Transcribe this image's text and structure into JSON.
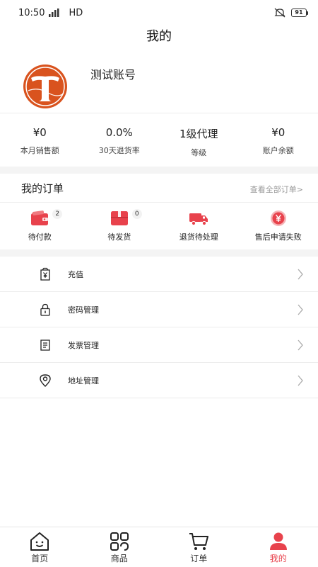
{
  "status_bar": {
    "time": "10:50",
    "network": "HD",
    "battery": "91"
  },
  "header": {
    "title": "我的"
  },
  "profile": {
    "username": "测试账号"
  },
  "stats": [
    {
      "value": "¥0",
      "label": "本月销售额"
    },
    {
      "value": "0.0%",
      "label": "30天退货率"
    },
    {
      "value": "1级代理",
      "label": "等级"
    },
    {
      "value": "¥0",
      "label": "账户余额"
    }
  ],
  "orders": {
    "title": "我的订单",
    "view_all": "查看全部订单>",
    "items": [
      {
        "label": "待付款",
        "badge": "2",
        "icon": "wallet-icon"
      },
      {
        "label": "待发货",
        "badge": "0",
        "icon": "gift-box-icon"
      },
      {
        "label": "退货待处理",
        "icon": "truck-icon"
      },
      {
        "label": "售后申请失败",
        "icon": "yen-coin-icon"
      }
    ]
  },
  "menu": [
    {
      "label": "充值",
      "icon": "recharge-icon"
    },
    {
      "label": "密码管理",
      "icon": "lock-icon"
    },
    {
      "label": "发票管理",
      "icon": "invoice-icon"
    },
    {
      "label": "地址管理",
      "icon": "location-icon"
    }
  ],
  "tabbar": [
    {
      "label": "首页",
      "icon": "home-icon"
    },
    {
      "label": "商品",
      "icon": "grid-icon"
    },
    {
      "label": "订单",
      "icon": "cart-icon"
    },
    {
      "label": "我的",
      "icon": "person-icon",
      "active": true
    }
  ],
  "colors": {
    "accent": "#e8424c",
    "logo": "#d9531e"
  }
}
